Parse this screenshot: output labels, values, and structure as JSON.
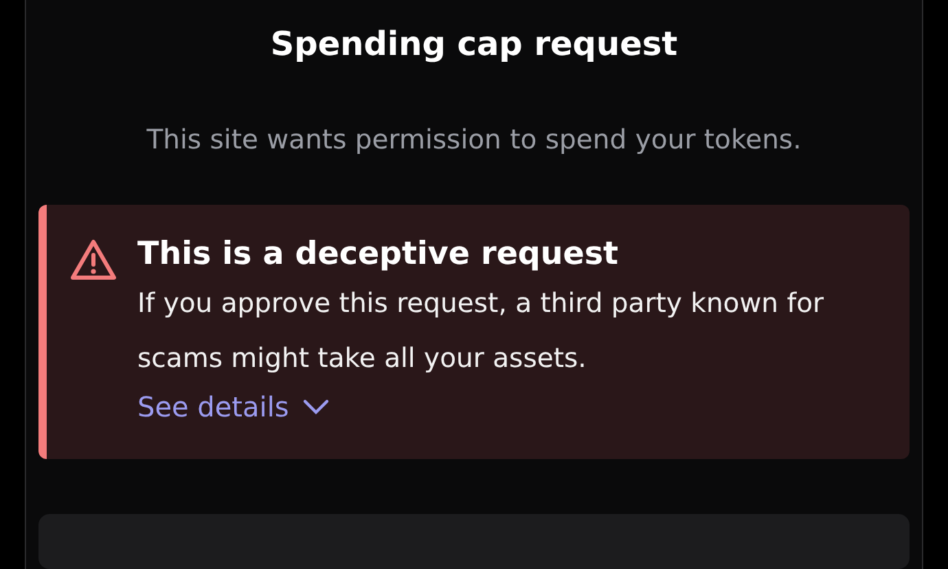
{
  "title": "Spending cap request",
  "subtitle": "This site wants permission to spend your tokens.",
  "alert": {
    "title": "This is a deceptive request",
    "message": "If you approve this request, a third party known for scams might take all your assets.",
    "link": "See details"
  }
}
